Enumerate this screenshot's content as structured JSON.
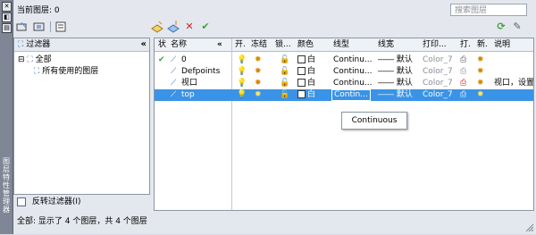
{
  "window": {
    "current_layer_label": "当前图层: 0",
    "search_placeholder": "搜索图层",
    "left_strip_text": "图层特性管理器"
  },
  "toolbar": {
    "left_icons": [
      "new-property-filter-icon",
      "new-group-filter-icon",
      "layer-states-icon"
    ],
    "right_icons": [
      "new-layer-icon",
      "new-layer-vp-frozen-icon",
      "delete-layer-icon",
      "set-current-icon"
    ],
    "far_right_icons": [
      "refresh-icon",
      "settings-icon"
    ]
  },
  "filters_panel": {
    "header": "过滤器",
    "collapse_glyph": "«",
    "tree": [
      {
        "label": "全部",
        "level": 0
      },
      {
        "label": "所有使用的图层",
        "level": 1
      }
    ],
    "invert_filter_label": "反转过滤器(I)"
  },
  "layers_panel": {
    "collapse_glyph": "«",
    "columns": [
      "状",
      "名称",
      "开.",
      "冻结",
      "锁...",
      "颜色",
      "线型",
      "线宽",
      "打印...",
      "打.",
      "新.",
      "说明"
    ],
    "rows": [
      {
        "status": "✔",
        "name": "0",
        "color": "白",
        "linetype": "Continu...",
        "lineweight": "默认",
        "plot_style": "Color_7",
        "description": ""
      },
      {
        "status": "",
        "name": "Defpoints",
        "color": "白",
        "linetype": "Continu...",
        "lineweight": "默认",
        "plot_style": "Color_7",
        "description": ""
      },
      {
        "status": "",
        "name": "视口",
        "color": "白",
        "linetype": "Continu...",
        "lineweight": "默认",
        "plot_style": "Color_7",
        "description": "视口，设置为"
      },
      {
        "status": "",
        "name": "top",
        "color": "白",
        "linetype": "Contin...",
        "lineweight": "默认",
        "plot_style": "Color_7",
        "description": ""
      }
    ],
    "selected_row": 3,
    "tooltip": "Continuous"
  },
  "status_bar": {
    "text": "全部: 显示了 4 个图层，共 4 个图层"
  },
  "colors": {
    "selection": "#3a93e6",
    "status_ok": "#3aa33a",
    "delete_red": "#d42020"
  }
}
